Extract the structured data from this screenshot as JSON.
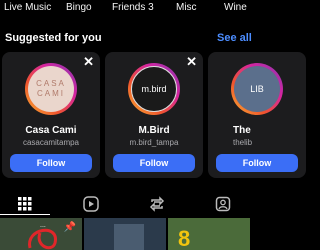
{
  "top_row": [
    "Live Music",
    "Bingo",
    "Friends 3",
    "Misc",
    "Wine"
  ],
  "section": {
    "title": "Suggested for you",
    "see_all": "See all"
  },
  "cards": [
    {
      "name": "Casa Cami",
      "handle": "casacamitampa",
      "avatar_text": "CASA CAMI",
      "follow": "Follow",
      "close": "✕"
    },
    {
      "name": "M.Bird",
      "handle": "m.bird_tampa",
      "avatar_text": "m.bird",
      "follow": "Follow",
      "close": "✕"
    },
    {
      "name": "The",
      "handle": "thelib",
      "avatar_text": "LIB",
      "follow": "Follow",
      "close": ""
    }
  ],
  "tabs": [
    {
      "icon": "grid-icon"
    },
    {
      "icon": "play-icon"
    },
    {
      "icon": "repost-icon"
    },
    {
      "icon": "tagged-icon"
    }
  ],
  "thumb1_caption": "...",
  "thumb3_text": "8"
}
